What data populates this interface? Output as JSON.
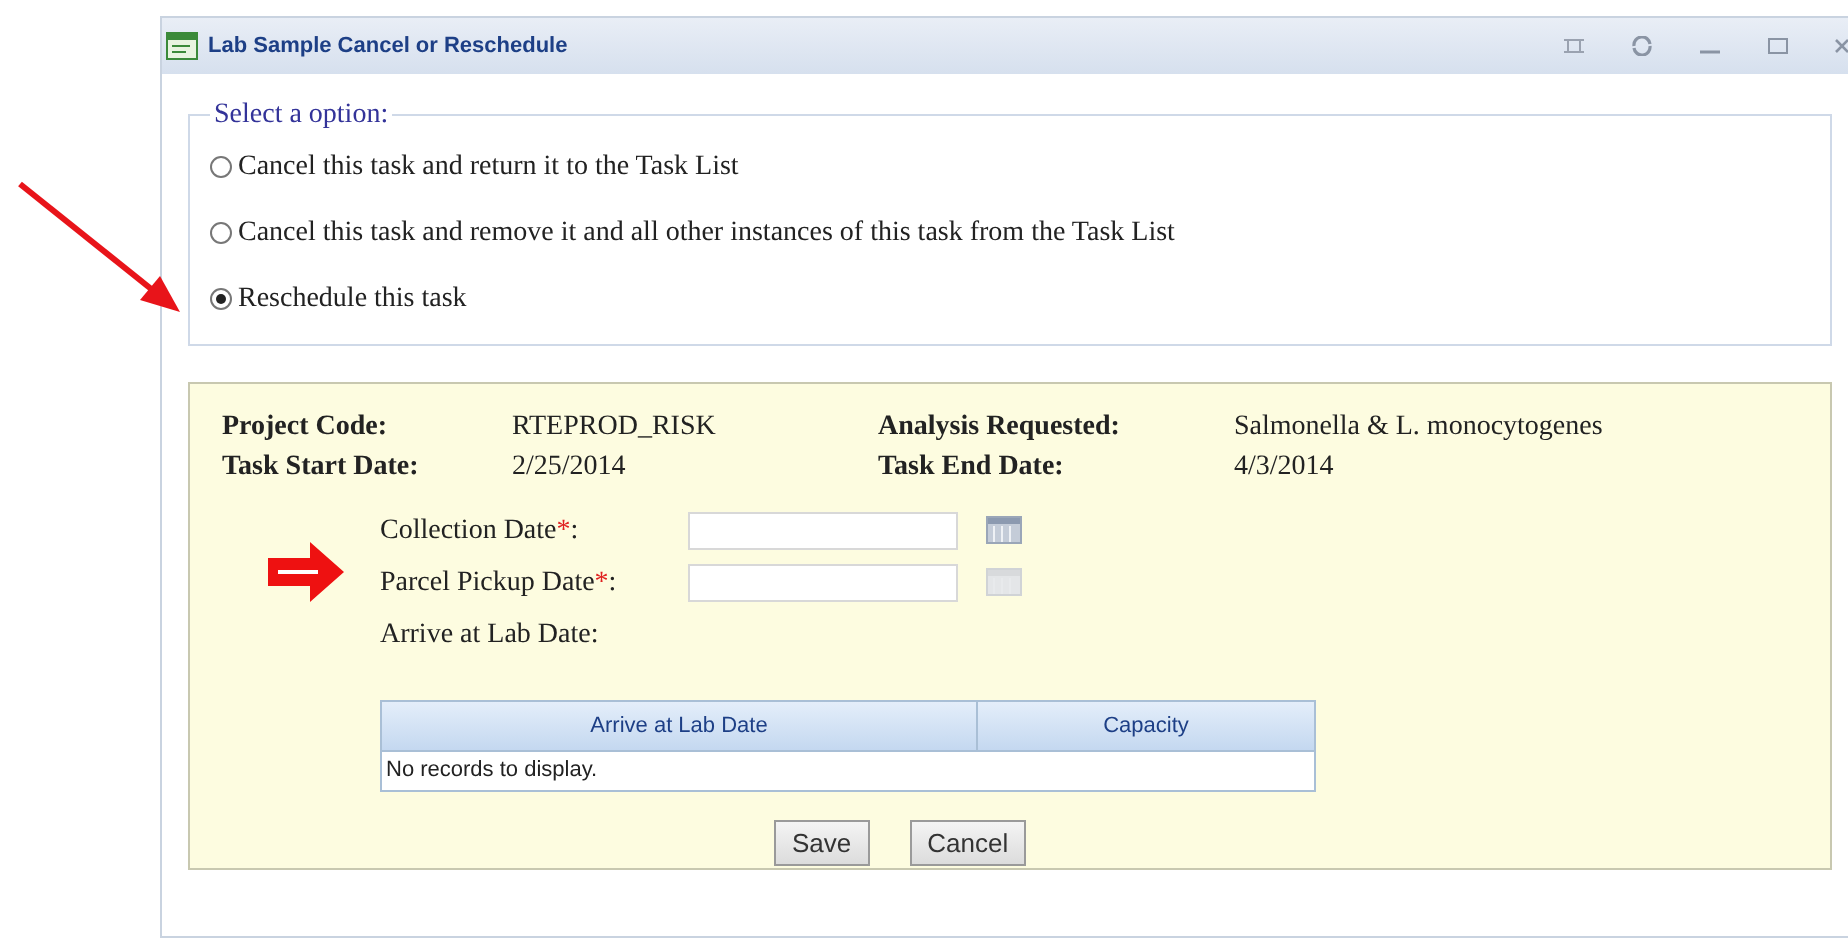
{
  "window": {
    "title": "Lab Sample Cancel or Reschedule"
  },
  "option_group": {
    "legend": "Select a option:",
    "options": [
      {
        "label": "Cancel this task and return it to the Task List",
        "selected": false
      },
      {
        "label": "Cancel this task and remove it and all other instances of this task from the Task List",
        "selected": false
      },
      {
        "label": "Reschedule this task",
        "selected": true
      }
    ]
  },
  "summary": [
    {
      "label": "Project Code:",
      "value": "RTEPROD_RISK",
      "label2": "Analysis Requested:",
      "value2": "Salmonella & L. monocytogenes"
    },
    {
      "label": "Task Start Date:",
      "value": "2/25/2014",
      "label2": "Task End Date:",
      "value2": "4/3/2014"
    }
  ],
  "fields": [
    {
      "kind": "date",
      "label": "Collection Date",
      "required_mark": "*",
      "colon": ":",
      "calendar_disabled": false
    },
    {
      "kind": "date",
      "label": "Parcel Pickup Date",
      "required_mark": "*",
      "colon": ":",
      "calendar_disabled": true
    },
    {
      "kind": "text",
      "label": "Arrive at Lab Date:"
    }
  ],
  "table": {
    "columns": [
      "Arrive at Lab Date",
      "Capacity"
    ],
    "empty_message": "No records to display."
  },
  "buttons": [
    "Save",
    "Cancel"
  ]
}
